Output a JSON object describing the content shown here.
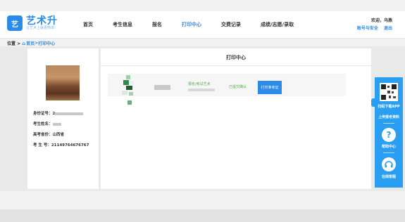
{
  "header": {
    "logo_mark": "艺",
    "logo_name": "艺术升",
    "logo_sub": "让艺术上就更简单!",
    "nav": [
      "首页",
      "考生信息",
      "报名",
      "打印中心",
      "交费记录",
      "成绩/志愿/录取"
    ],
    "active_nav": "打印中心",
    "user_greeting": "欢迎，乌燕",
    "user_links": [
      "账号与安全",
      "退出"
    ]
  },
  "breadcrumb": {
    "prefix": "位置 >",
    "home": "首页",
    "sep": ">",
    "current": "打印中心"
  },
  "profile": {
    "rows": [
      {
        "label": "身份证号：",
        "value": "2"
      },
      {
        "label": "考生姓名：",
        "value": ""
      },
      {
        "label": "高考省份：",
        "value": "山西省"
      },
      {
        "label": "考 生 号：",
        "value": "21149764676767"
      }
    ]
  },
  "print_center": {
    "title": "打印中心",
    "row": {
      "school_text": "报名/考试艺术",
      "status_text": "已提交确认",
      "button_label": "打印准考证"
    }
  },
  "sidebar": {
    "app_text": "扫码下载APP",
    "upload_text": "上传报考资料",
    "help_icon": "?",
    "help_text": "帮助中心",
    "service_text": "在线客服"
  },
  "colors": {
    "brand": "#2a8be8",
    "sidebar": "#2a9ef0",
    "green": "#5aaa50"
  }
}
